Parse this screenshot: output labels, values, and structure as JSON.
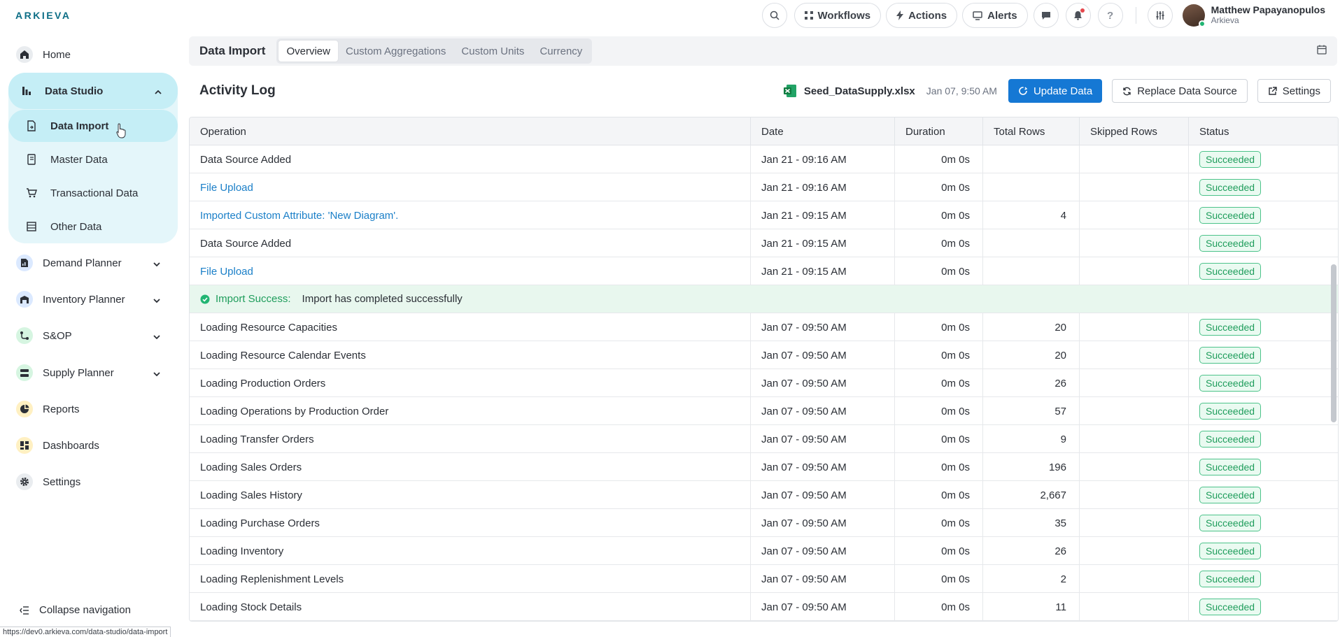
{
  "app": {
    "logo_text": "ARKIEVA"
  },
  "topbar": {
    "workflows_label": "Workflows",
    "actions_label": "Actions",
    "alerts_label": "Alerts",
    "user_name": "Matthew Papayanopulos",
    "user_org": "Arkieva",
    "icons": [
      "search-icon",
      "workflows-icon",
      "actions-bolt-icon",
      "alerts-monitor-icon",
      "chat-icon",
      "bell-icon",
      "help-icon",
      "sliders-icon"
    ]
  },
  "sidebar": {
    "home": "Home",
    "data_studio": "Data Studio",
    "sub_items": [
      "Data Import",
      "Master Data",
      "Transactional Data",
      "Other Data"
    ],
    "demand_planner": "Demand Planner",
    "inventory_planner": "Inventory Planner",
    "sop": "S&OP",
    "supply_planner": "Supply Planner",
    "reports": "Reports",
    "dashboards": "Dashboards",
    "settings": "Settings",
    "collapse": "Collapse navigation"
  },
  "tabbar": {
    "title": "Data Import",
    "tabs": [
      "Overview",
      "Custom Aggregations",
      "Custom Units",
      "Currency"
    ],
    "active_tab": "Overview"
  },
  "activity": {
    "title": "Activity Log",
    "file_name": "Seed_DataSupply.xlsx",
    "file_date": "Jan 07, 9:50 AM",
    "update_label": "Update Data",
    "replace_label": "Replace Data Source",
    "settings_label": "Settings"
  },
  "table": {
    "columns": [
      "Operation",
      "Date",
      "Duration",
      "Total Rows",
      "Skipped Rows",
      "Status"
    ],
    "rows_top": [
      {
        "op": "Data Source Added",
        "date": "Jan 21 - 09:16 AM",
        "duration": "0m 0s",
        "total": "",
        "skipped": "",
        "status": "Succeeded"
      },
      {
        "op": "File Upload",
        "date": "Jan 21 - 09:16 AM",
        "duration": "0m 0s",
        "total": "",
        "skipped": "",
        "status": "Succeeded"
      },
      {
        "op": "Imported Custom Attribute: 'New Diagram'.",
        "date": "Jan 21 - 09:15 AM",
        "duration": "0m 0s",
        "total": "4",
        "skipped": "",
        "status": "Succeeded"
      },
      {
        "op": "Data Source Added",
        "date": "Jan 21 - 09:15 AM",
        "duration": "0m 0s",
        "total": "",
        "skipped": "",
        "status": "Succeeded"
      },
      {
        "op": "File Upload",
        "date": "Jan 21 - 09:15 AM",
        "duration": "0m 0s",
        "total": "",
        "skipped": "",
        "status": "Succeeded"
      }
    ],
    "success_banner": {
      "label": "Import Success:",
      "message": "Import has completed successfully"
    },
    "rows_bottom": [
      {
        "op": "Loading Resource Capacities",
        "date": "Jan 07 - 09:50 AM",
        "duration": "0m 0s",
        "total": "20",
        "skipped": "",
        "status": "Succeeded"
      },
      {
        "op": "Loading Resource Calendar Events",
        "date": "Jan 07 - 09:50 AM",
        "duration": "0m 0s",
        "total": "20",
        "skipped": "",
        "status": "Succeeded"
      },
      {
        "op": "Loading Production Orders",
        "date": "Jan 07 - 09:50 AM",
        "duration": "0m 0s",
        "total": "26",
        "skipped": "",
        "status": "Succeeded"
      },
      {
        "op": "Loading Operations by Production Order",
        "date": "Jan 07 - 09:50 AM",
        "duration": "0m 0s",
        "total": "57",
        "skipped": "",
        "status": "Succeeded"
      },
      {
        "op": "Loading Transfer Orders",
        "date": "Jan 07 - 09:50 AM",
        "duration": "0m 0s",
        "total": "9",
        "skipped": "",
        "status": "Succeeded"
      },
      {
        "op": "Loading Sales Orders",
        "date": "Jan 07 - 09:50 AM",
        "duration": "0m 0s",
        "total": "196",
        "skipped": "",
        "status": "Succeeded"
      },
      {
        "op": "Loading Sales History",
        "date": "Jan 07 - 09:50 AM",
        "duration": "0m 0s",
        "total": "2,667",
        "skipped": "",
        "status": "Succeeded"
      },
      {
        "op": "Loading Purchase Orders",
        "date": "Jan 07 - 09:50 AM",
        "duration": "0m 0s",
        "total": "35",
        "skipped": "",
        "status": "Succeeded"
      },
      {
        "op": "Loading Inventory",
        "date": "Jan 07 - 09:50 AM",
        "duration": "0m 0s",
        "total": "26",
        "skipped": "",
        "status": "Succeeded"
      },
      {
        "op": "Loading Replenishment Levels",
        "date": "Jan 07 - 09:50 AM",
        "duration": "0m 0s",
        "total": "2",
        "skipped": "",
        "status": "Succeeded"
      },
      {
        "op": "Loading Stock Details",
        "date": "Jan 07 - 09:50 AM",
        "duration": "0m 0s",
        "total": "11",
        "skipped": "",
        "status": "Succeeded"
      }
    ]
  },
  "statusbar": {
    "url": "https://dev0.arkieva.com/data-studio/data-import"
  },
  "colors": {
    "brand": "#0d6e86",
    "primary": "#1578d4",
    "success": "#1f9d5c",
    "active_nav": "#c5eef6"
  }
}
